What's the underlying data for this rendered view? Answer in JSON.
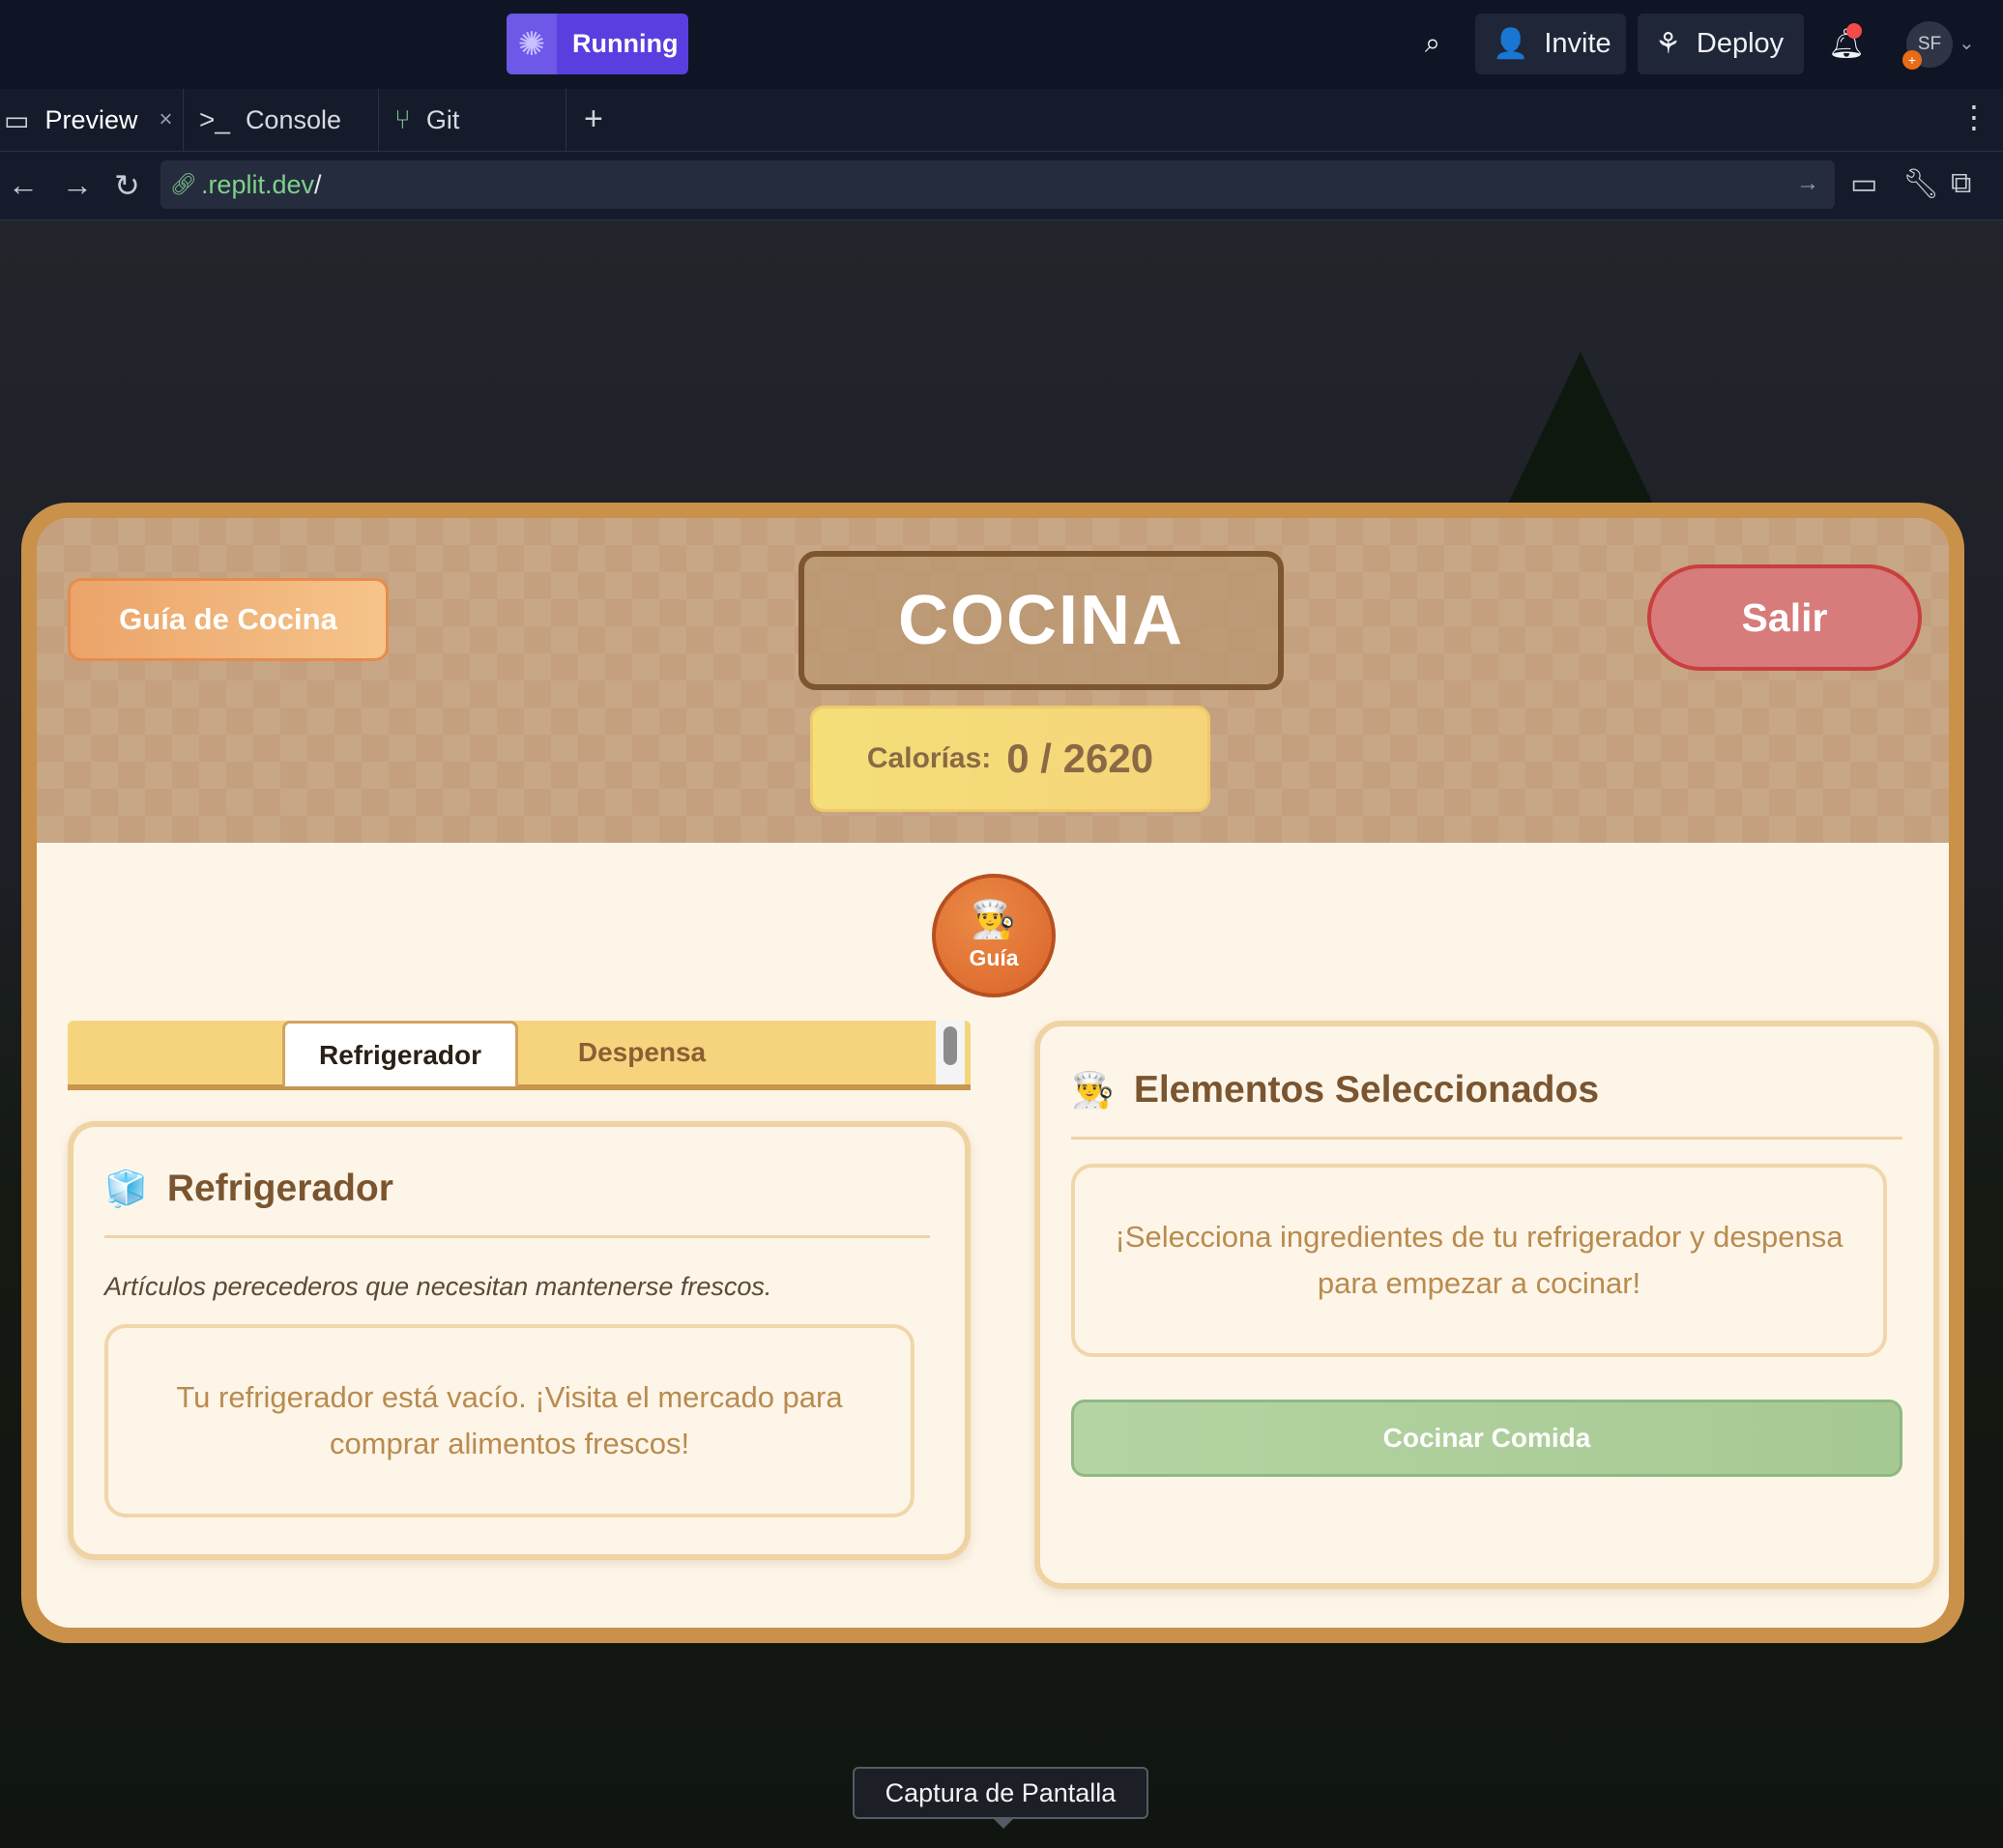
{
  "topbar": {
    "run_label": "Running",
    "invite_label": "Invite",
    "deploy_label": "Deploy",
    "avatar_initials": "SF"
  },
  "tabs": [
    {
      "label": "Preview",
      "icon": "monitor-icon"
    },
    {
      "label": "Console",
      "icon": "terminal-icon"
    },
    {
      "label": "Git",
      "icon": "git-branch-icon"
    }
  ],
  "addressbar": {
    "url_domain": ".replit.dev",
    "url_path": "/"
  },
  "kitchen": {
    "guide_button": "Guía de Cocina",
    "title": "COCINA",
    "calories_label": "Calorías:",
    "calories_value": "0 / 2620",
    "exit_button": "Salir",
    "chef_label": "Guía",
    "storage_tabs": [
      "Refrigerador",
      "Despensa"
    ],
    "fridge": {
      "title": "Refrigerador",
      "description": "Artículos perecederos que necesitan mantenerse frescos.",
      "empty_message": "Tu refrigerador está vacío. ¡Visita el mercado para comprar alimentos frescos!"
    },
    "selected": {
      "title": "Elementos Seleccionados",
      "empty_message": "¡Selecciona ingredientes de tu refrigerador y despensa para empezar a cocinar!",
      "cook_button": "Cocinar Comida"
    }
  },
  "tooltip": "Captura de Pantalla",
  "colors": {
    "run_button": "#5b3ee0",
    "modal_border": "#c9914a",
    "exit_button": "#d77b7b",
    "cook_button": "#b5d4a3",
    "calories_bg": "#f4df79"
  }
}
